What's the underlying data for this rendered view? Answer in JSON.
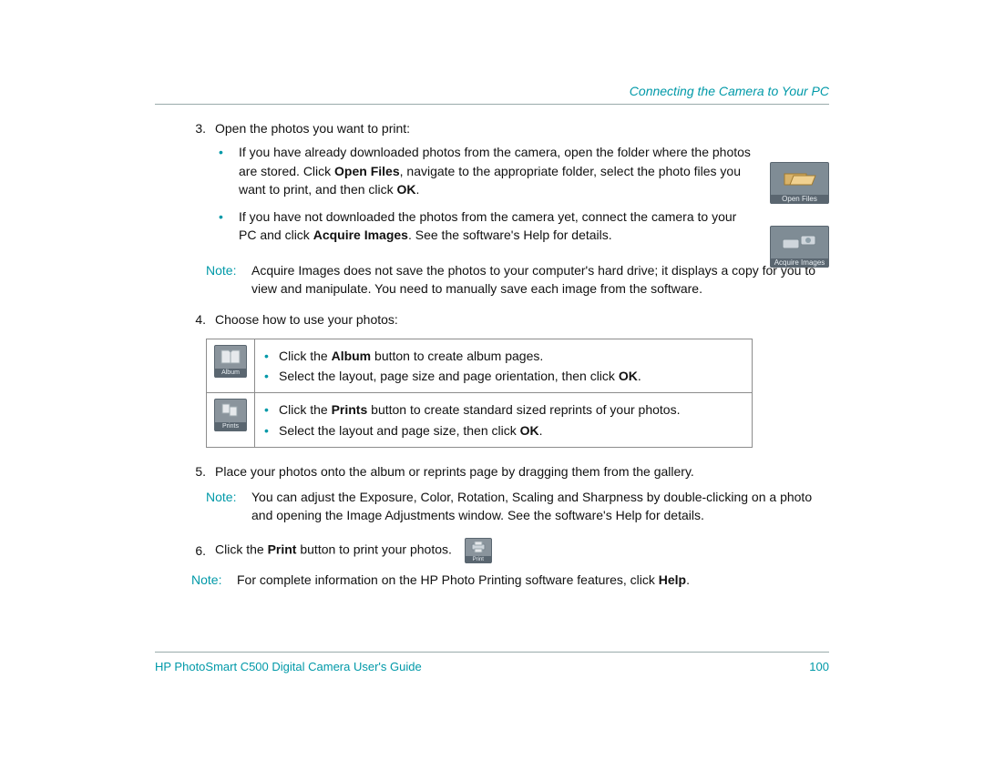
{
  "header": {
    "section": "Connecting the Camera to Your PC"
  },
  "icons": {
    "open_files_caption": "Open Files",
    "acquire_caption": "Acquire Images",
    "album_caption": "Album",
    "prints_caption": "Prints",
    "print_caption": "Print"
  },
  "step3": {
    "num": "3.",
    "intro": "Open the photos you want to print:",
    "b1_pre": "If you have already downloaded photos from the camera, open the folder where the photos are stored. Click ",
    "b1_bold1": "Open Files",
    "b1_mid": ", navigate to the appropriate folder, select the photo files you want to print, and then click ",
    "b1_bold2": "OK",
    "b1_post": ".",
    "b2_pre": "If you have not downloaded the photos from the camera yet, connect the camera to your PC and click ",
    "b2_bold": "Acquire Images",
    "b2_post": ". See the software's Help for details."
  },
  "note1": {
    "label": "Note:",
    "text": "Acquire Images does not save the photos to your computer's hard drive; it displays a copy for you to view and manipulate. You need to manually save each image from the software."
  },
  "step4": {
    "num": "4.",
    "intro": "Choose how to use your photos:",
    "r1b1_pre": "Click the ",
    "r1b1_bold": "Album",
    "r1b1_post": " button to create album pages.",
    "r1b2_pre": "Select the layout, page size and page orientation, then click ",
    "r1b2_bold": "OK",
    "r1b2_post": ".",
    "r2b1_pre": "Click the ",
    "r2b1_bold": "Prints",
    "r2b1_post": " button to create standard sized reprints of your photos.",
    "r2b2_pre": "Select the layout and page size, then click ",
    "r2b2_bold": "OK",
    "r2b2_post": "."
  },
  "step5": {
    "num": "5.",
    "text": "Place your photos onto the album or reprints page by dragging them from the gallery."
  },
  "note2": {
    "label": "Note:",
    "text": "You can adjust the Exposure, Color, Rotation, Scaling and Sharpness by double-clicking on a photo and opening the Image Adjustments window. See the software's Help for details."
  },
  "step6": {
    "num": "6.",
    "pre": "Click the ",
    "bold": "Print",
    "post": " button to print your photos."
  },
  "note3": {
    "label": "Note:",
    "pre": "For complete information on the HP Photo Printing software features, click ",
    "bold": "Help",
    "post": "."
  },
  "footer": {
    "guide": "HP PhotoSmart C500 Digital Camera User's Guide",
    "page": "100"
  }
}
